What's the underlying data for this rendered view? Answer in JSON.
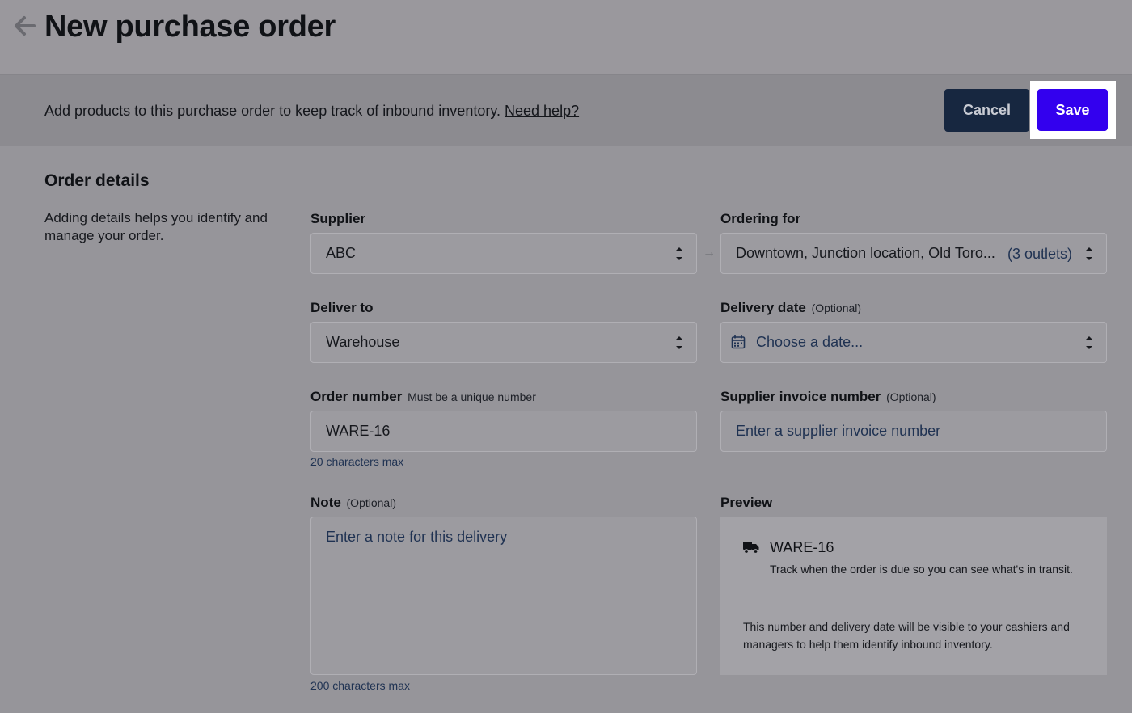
{
  "header": {
    "title": "New purchase order"
  },
  "action_bar": {
    "text": "Add products to this purchase order to keep track of inbound inventory.",
    "help_link": "Need help?",
    "cancel_label": "Cancel",
    "save_label": "Save"
  },
  "section": {
    "title": "Order details",
    "description": "Adding details helps you identify and manage your order."
  },
  "form": {
    "supplier": {
      "label": "Supplier",
      "value": "ABC"
    },
    "ordering_for": {
      "label": "Ordering for",
      "value": "Downtown, Junction location, Old Toro...",
      "count": "(3 outlets)"
    },
    "deliver_to": {
      "label": "Deliver to",
      "value": "Warehouse"
    },
    "delivery_date": {
      "label": "Delivery date",
      "sublabel": "(Optional)",
      "placeholder": "Choose a date..."
    },
    "order_number": {
      "label": "Order number",
      "sublabel": "Must be a unique number",
      "value": "WARE-16",
      "hint": "20 characters max"
    },
    "supplier_invoice": {
      "label": "Supplier invoice number",
      "sublabel": "(Optional)",
      "placeholder": "Enter a supplier invoice number"
    },
    "note": {
      "label": "Note",
      "sublabel": "(Optional)",
      "placeholder": "Enter a note for this delivery",
      "hint": "200 characters max"
    }
  },
  "preview": {
    "label": "Preview",
    "number": "WARE-16",
    "caption": "Track when the order is due so you can see what's in transit.",
    "note": "This number and delivery date will be visible to your cashiers and managers to help them identify inbound inventory."
  },
  "colors": {
    "save_accent": "#3300ee",
    "cancel_bg": "#172740",
    "link_text": "#1f3252"
  },
  "icons": [
    "back-arrow-icon",
    "select-stepper-icon",
    "arrow-right-icon",
    "calendar-icon",
    "truck-icon"
  ]
}
